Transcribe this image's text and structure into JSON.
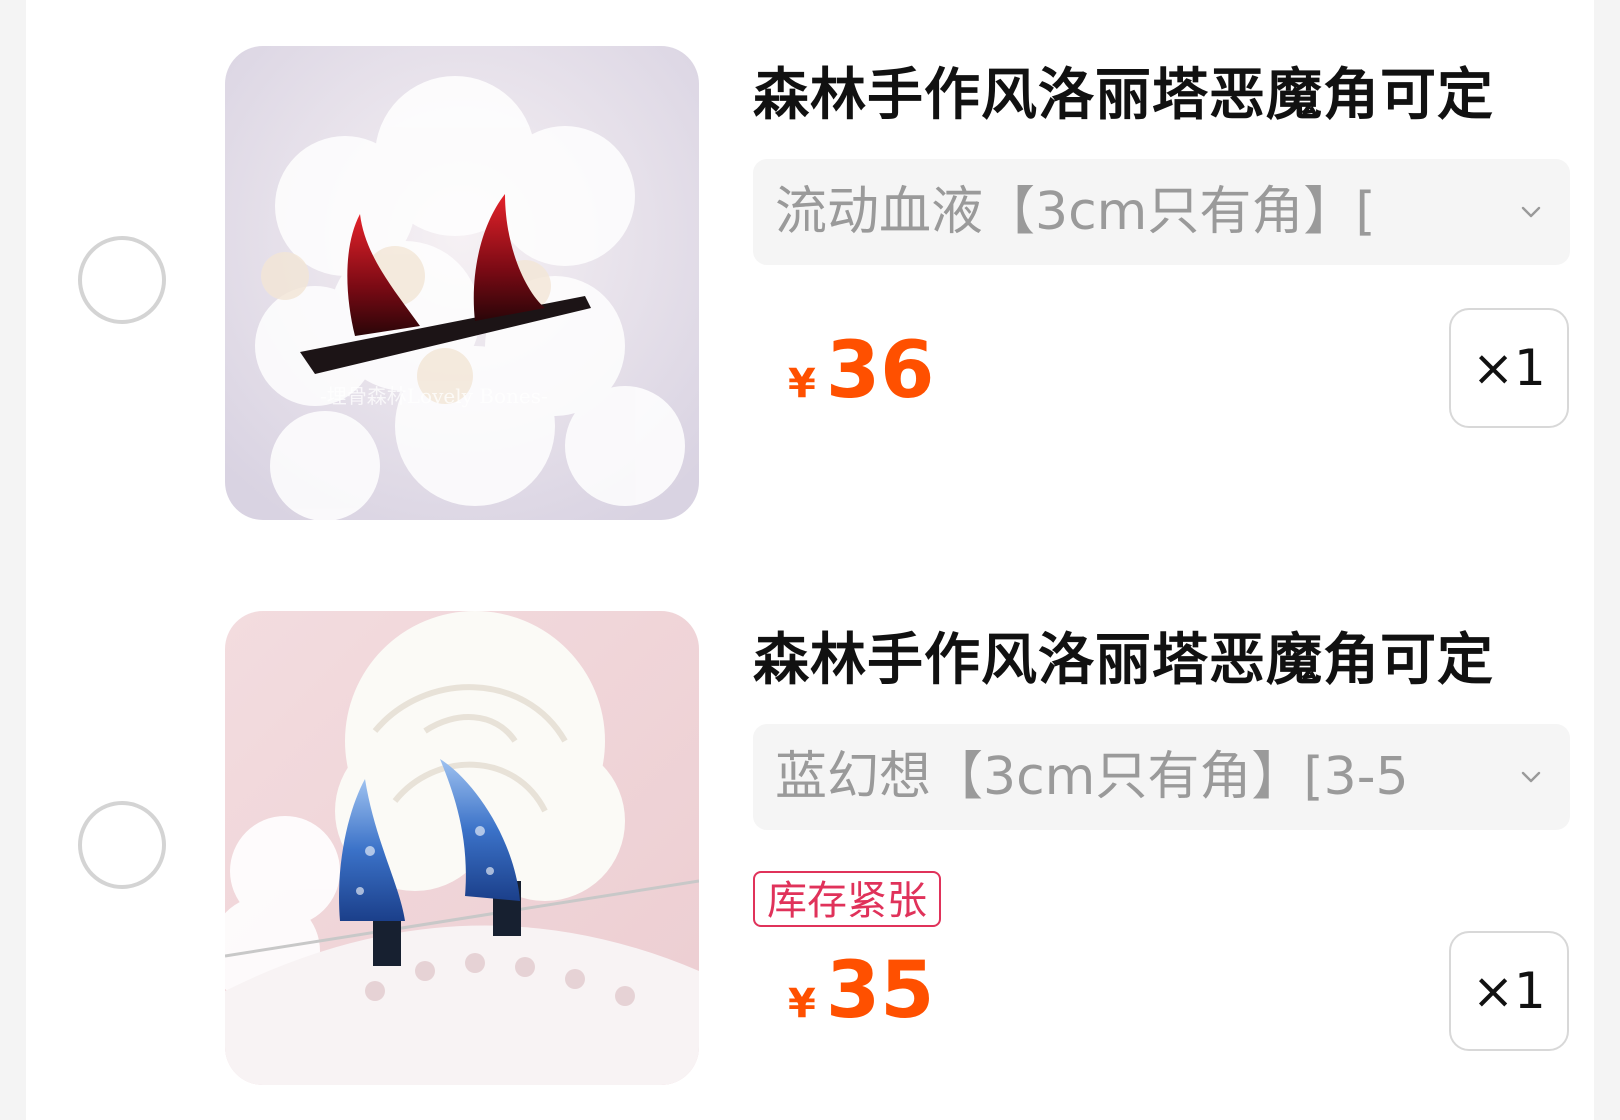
{
  "cart": {
    "items": [
      {
        "title": "森林手作风洛丽塔恶魔角可定",
        "sku": "流动血液【3cm只有角】[",
        "currency": "¥",
        "price": "36",
        "quantity": "×1",
        "badge": ""
      },
      {
        "title": "森林手作风洛丽塔恶魔角可定",
        "sku": "蓝幻想【3cm只有角】[3-5",
        "currency": "¥",
        "price": "35",
        "quantity": "×1",
        "badge": "库存紧张"
      }
    ],
    "watermark": "-埋骨森林Lovely Bones-"
  },
  "colors": {
    "price": "#ff5000",
    "badge": "#e0325a",
    "sku_text": "#9a9a9a"
  }
}
